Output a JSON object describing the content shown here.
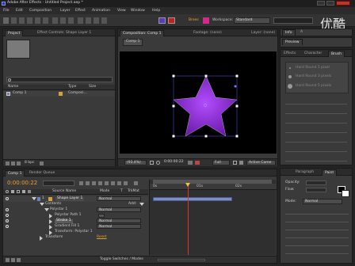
{
  "window": {
    "title": "Adobe After Effects - Untitled Project.aep *"
  },
  "menu": [
    "File",
    "Edit",
    "Composition",
    "Layer",
    "Effect",
    "Animation",
    "View",
    "Window",
    "Help"
  ],
  "toolbar": {
    "workspace_label": "Workspace:",
    "workspace_value": "Standard",
    "brand_text": "Brees",
    "watermark": "优酷"
  },
  "project_panel": {
    "tab_project": "Project",
    "tab_effect_controls": "Effect Controls: Shape Layer 1",
    "col_name": "Name",
    "col_type": "Type",
    "col_size": "Size",
    "item_name": "Comp 1",
    "item_type": "Composi...",
    "footer_bpc": "8 bpc"
  },
  "comp_panel": {
    "tab_composition": "Composition: Comp 1",
    "tab_footage": "Footage: (none)",
    "tab_layer": "Layer: (none)",
    "crumb": "Comp 1",
    "zoom": "(93.4%)",
    "timecode": "0:00:00:22",
    "resolution": "Full",
    "camera": "Active Came"
  },
  "right_panels": {
    "info": "Info",
    "audio": "A",
    "preview": "Preview",
    "effects": "Effects",
    "character": "Character",
    "brush": "Brush",
    "paragraph": "Paragraph",
    "paint": "Paint",
    "brush_items": [
      "Hard Round 1 pixel",
      "Hard Round 3 pixels",
      "Hard Round 5 pixels"
    ],
    "paint_opacity_label": "Opacity:",
    "paint_flow_label": "Flow:",
    "paint_mode_label": "Mode:",
    "paint_mode_value": "Normal"
  },
  "timeline": {
    "tab_comp": "Comp 1",
    "tab_render": "Render Queue",
    "timecode": "0:00:00:22",
    "col_source_name": "Source Name",
    "col_mode": "Mode",
    "col_t": "T",
    "col_trkmat": "TrkMat",
    "add_label": "Add:",
    "ruler": [
      "0s",
      "01s",
      "02s"
    ],
    "layers": [
      {
        "num": "1",
        "name": "Shape Layer 1",
        "mode": "Normal"
      },
      {
        "name": "Contents"
      },
      {
        "name": "Polystar 1",
        "mode": "Normal"
      },
      {
        "name": "Polystar Path 1"
      },
      {
        "name": "Stroke 1",
        "mode": "Normal"
      },
      {
        "name": "Gradient Fill 1",
        "mode": "Normal"
      },
      {
        "name": "Transform: Polystar 1"
      },
      {
        "name": "Transform",
        "extra": "Reset"
      }
    ],
    "footer": "Toggle Switches / Modes"
  },
  "colors": {
    "star_fill_outer": "#6a1aa6",
    "star_fill_inner": "#b14dff",
    "accent_orange": "#f0a030",
    "layer_bar": "#7d8fc2",
    "current_time_indicator": "#e03030"
  }
}
